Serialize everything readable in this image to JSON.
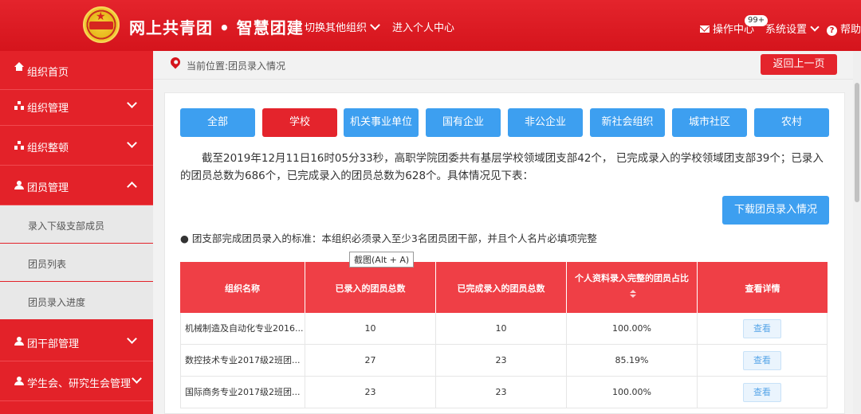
{
  "header": {
    "app_title": "网上共青团 • 智慧团建",
    "nav_switch": "切换其他组织",
    "nav_personal": "进入个人中心",
    "ops_center": "操作中心",
    "badge": "99+",
    "system_settings": "系统设置",
    "help": "帮助"
  },
  "sidebar": {
    "items": [
      {
        "label": "组织首页",
        "icon": "home-icon"
      },
      {
        "label": "组织管理",
        "icon": "org-chart-icon"
      },
      {
        "label": "组织整顿",
        "icon": "org-chart-icon"
      },
      {
        "label": "团员管理",
        "icon": "users-icon"
      },
      {
        "label": "团干部管理",
        "icon": "users-icon"
      },
      {
        "label": "学生会、研究生会管理",
        "icon": "users-icon"
      }
    ],
    "sub_items": [
      {
        "label": "录入下级支部成员"
      },
      {
        "label": "团员列表"
      },
      {
        "label": "团员录入进度"
      }
    ]
  },
  "breadcrumb": {
    "text": "当前位置:团员录入情况",
    "back_label": "返回上一页"
  },
  "filters": {
    "items": [
      "全部",
      "学校",
      "机关事业单位",
      "国有企业",
      "非公企业",
      "新社会组织",
      "城市社区",
      "农村"
    ],
    "active": "学校"
  },
  "summary": "截至2019年12月11日16时05分33秒，高职学院团委共有基层学校领域团支部42个， 已完成录入的学校领域团支部39个；已录入的团员总数为686个，已完成录入的团员总数为628个。具体情况见下表：",
  "download_label": "下载团员录入情况",
  "standard_note": "● 团支部完成团员录入的标准：本组织必须录入至少3名团员团干部，并且个人名片必填项完整",
  "tooltip": "截图(Alt + A)",
  "table": {
    "headers": [
      "组织名称",
      "已录入的团员总数",
      "已完成录入的团员总数",
      "个人资料录入完整的团员占比",
      "查看详情"
    ],
    "rows": [
      {
        "name": "机械制造及自动化专业2016...",
        "entered": "10",
        "completed": "10",
        "ratio": "100.00%",
        "action": "查看"
      },
      {
        "name": "数控技术专业2017级2班团...",
        "entered": "27",
        "completed": "23",
        "ratio": "85.19%",
        "action": "查看"
      },
      {
        "name": "国际商务专业2017级2班团...",
        "entered": "23",
        "completed": "23",
        "ratio": "100.00%",
        "action": "查看"
      }
    ]
  },
  "colors": {
    "brand_red": "#e4242c",
    "accent_blue": "#3d9ff0",
    "table_header": "#ef3f46"
  }
}
